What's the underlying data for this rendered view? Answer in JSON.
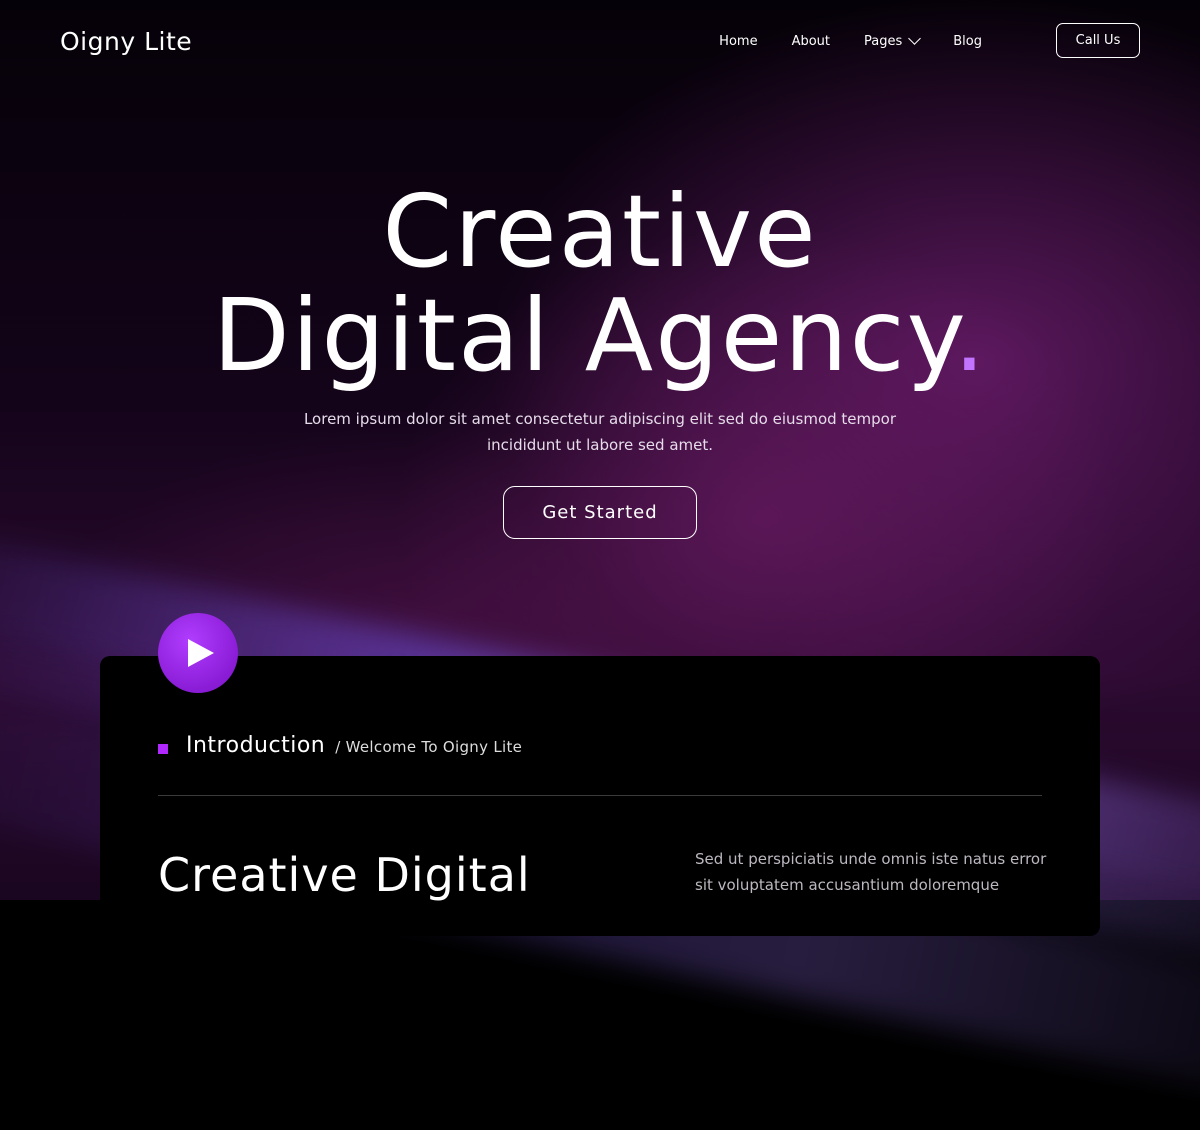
{
  "header": {
    "logo": "Oigny Lite",
    "nav": [
      {
        "label": "Home"
      },
      {
        "label": "About"
      },
      {
        "label": "Pages"
      },
      {
        "label": "Blog"
      }
    ],
    "call_label": "Call Us"
  },
  "hero": {
    "title_line1": "Creative",
    "title_line2": "Digital Agency",
    "title_dot": ".",
    "subtitle": "Lorem ipsum dolor sit amet consectetur adipiscing elit sed do eiusmod tempor incididunt ut labore sed amet.",
    "cta_label": "Get Started"
  },
  "intro": {
    "title": "Introduction",
    "crumb": "/ Welcome To Oigny Lite",
    "heading": "Creative Digital",
    "description": "Sed ut perspiciatis unde omnis iste natus error sit voluptatem accusantium doloremque"
  },
  "icons": {
    "play": "play-icon",
    "pages_dropdown": "chevron-down-icon"
  },
  "colors": {
    "accent": "#b128ff",
    "dot": "#c273ff",
    "play_button": "#8a1cd6",
    "background": "#000000"
  }
}
